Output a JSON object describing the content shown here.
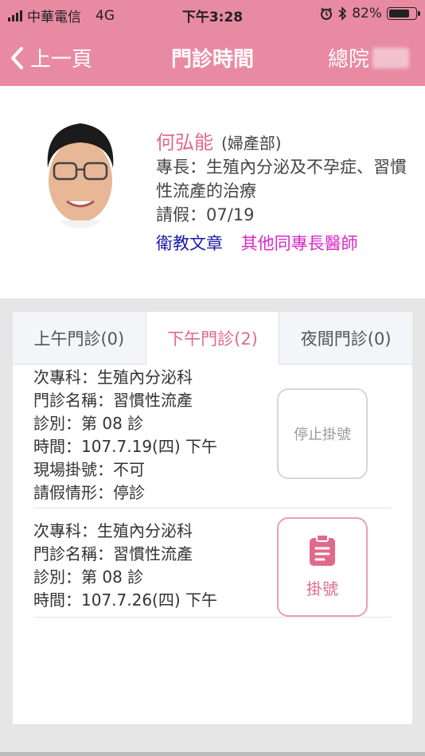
{
  "status_bar": {
    "carrier": "中華電信",
    "network": "4G",
    "time": "下午3:28",
    "battery_label": "82%",
    "battery_level": 0.82
  },
  "nav": {
    "back_label": "上一頁",
    "title": "門診時間",
    "branch": "總院"
  },
  "doctor": {
    "name": "何弘能",
    "dept": "(婦產部)",
    "specialty": "專長：生殖內分泌及不孕症、習慣性流產的治療",
    "leave": "請假：07/19",
    "link_edu": "衛教文章",
    "link_other": "其他同專長醫師"
  },
  "tabs": [
    {
      "label": "上午門診(0)"
    },
    {
      "label": "下午門診(2)"
    },
    {
      "label": "夜間門診(0)"
    }
  ],
  "sessions": [
    {
      "lines": [
        "次專科：生殖內分泌科",
        "門診名稱：習慣性流產",
        "診別：第 08 診",
        "時間：107.7.19(四) 下午",
        "現場掛號：不可",
        "請假情形：停診"
      ],
      "button": "停止掛號"
    },
    {
      "lines": [
        "次專科：生殖內分泌科",
        "門診名稱：習慣性流產",
        "診別：第 08 診",
        "時間：107.7.26(四) 下午"
      ],
      "button": "掛號"
    }
  ],
  "colors": {
    "header": "#e98aa3",
    "accent": "#e06a8c",
    "link_blue": "#1a1aa8",
    "link_magenta": "#d928c8"
  },
  "icons": [
    "signal-icon",
    "alarm-icon",
    "bluetooth-icon",
    "battery-icon",
    "chevron-left-icon",
    "clipboard-icon"
  ]
}
